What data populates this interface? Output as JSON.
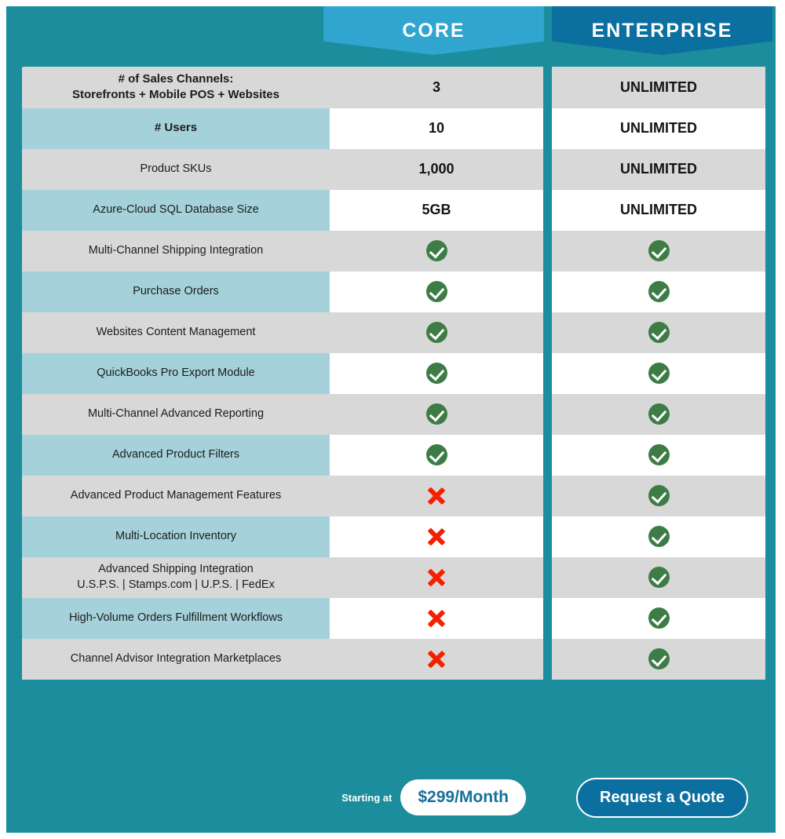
{
  "theme": {
    "frame_color": "#1b8d9c",
    "core_accent": "#2fa5d0",
    "enterprise_accent": "#0b6f9f",
    "row_gray": "#d8d8d8",
    "row_teal": "#a5d2da",
    "check_color": "#3d7d45",
    "cross_color": "#f52000"
  },
  "plans": {
    "core": {
      "name": "CORE"
    },
    "enterprise": {
      "name": "ENTERPRISE"
    }
  },
  "rows": [
    {
      "label": "# of Sales Channels:\nStorefronts + Mobile POS + Websites",
      "bold": true,
      "core": "3",
      "enterprise": "UNLIMITED",
      "core_type": "text",
      "enterprise_type": "text"
    },
    {
      "label": "# Users",
      "bold": true,
      "core": "10",
      "enterprise": "UNLIMITED",
      "core_type": "text",
      "enterprise_type": "text"
    },
    {
      "label": "Product SKUs",
      "bold": false,
      "core": "1,000",
      "enterprise": "UNLIMITED",
      "core_type": "text",
      "enterprise_type": "text"
    },
    {
      "label": "Azure-Cloud SQL Database Size",
      "bold": false,
      "core": "5GB",
      "enterprise": "UNLIMITED",
      "core_type": "text",
      "enterprise_type": "text"
    },
    {
      "label": "Multi-Channel Shipping Integration",
      "bold": false,
      "core": "included",
      "enterprise": "included",
      "core_type": "check",
      "enterprise_type": "check"
    },
    {
      "label": "Purchase Orders",
      "bold": false,
      "core": "included",
      "enterprise": "included",
      "core_type": "check",
      "enterprise_type": "check"
    },
    {
      "label": "Websites Content Management",
      "bold": false,
      "core": "included",
      "enterprise": "included",
      "core_type": "check",
      "enterprise_type": "check"
    },
    {
      "label": "QuickBooks Pro Export Module",
      "bold": false,
      "core": "included",
      "enterprise": "included",
      "core_type": "check",
      "enterprise_type": "check"
    },
    {
      "label": "Multi-Channel Advanced Reporting",
      "bold": false,
      "core": "included",
      "enterprise": "included",
      "core_type": "check",
      "enterprise_type": "check"
    },
    {
      "label": "Advanced Product Filters",
      "bold": false,
      "core": "included",
      "enterprise": "included",
      "core_type": "check",
      "enterprise_type": "check"
    },
    {
      "label": "Advanced Product Management Features",
      "bold": false,
      "core": "not included",
      "enterprise": "included",
      "core_type": "cross",
      "enterprise_type": "check"
    },
    {
      "label": "Multi-Location Inventory",
      "bold": false,
      "core": "not included",
      "enterprise": "included",
      "core_type": "cross",
      "enterprise_type": "check"
    },
    {
      "label": "Advanced Shipping Integration\nU.S.P.S. | Stamps.com | U.P.S. | FedEx",
      "bold": false,
      "core": "not included",
      "enterprise": "included",
      "core_type": "cross",
      "enterprise_type": "check"
    },
    {
      "label": "High-Volume Orders Fulfillment Workflows",
      "bold": false,
      "core": "not included",
      "enterprise": "included",
      "core_type": "cross",
      "enterprise_type": "check"
    },
    {
      "label": "Channel Advisor Integration Marketplaces",
      "bold": false,
      "core": "not included",
      "enterprise": "included",
      "core_type": "cross",
      "enterprise_type": "check"
    }
  ],
  "footer": {
    "starting_at_label": "Starting at",
    "core_price": "$299/Month",
    "enterprise_cta": "Request a Quote"
  }
}
